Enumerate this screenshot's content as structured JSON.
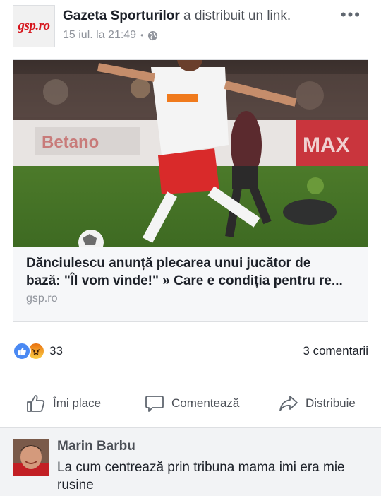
{
  "post": {
    "logo_text": "gsp.ro",
    "page_name": "Gazeta Sporturilor",
    "action_text": "a distribuit un link.",
    "timestamp": "15 iul. la 21:49",
    "separator": "•",
    "more_label": "•••",
    "privacy_icon": "globe-icon"
  },
  "link": {
    "headline_line1": "Dănciulescu anunță plecarea unui jucător de",
    "headline_line2": "bază: \"Îl vom vinde!\" » Care e condiția pentru re...",
    "domain": "gsp.ro",
    "photo_sponsor": "orange"
  },
  "reactions": {
    "count": "33",
    "types": [
      "like",
      "angry"
    ],
    "comments_count": "3 comentarii"
  },
  "actions": {
    "like_label": "Îmi place",
    "comment_label": "Comentează",
    "share_label": "Distribuie"
  },
  "comment": {
    "author": "Marin Barbu",
    "text": "La cum centrează prin tribuna mama imi era mie rusine"
  },
  "colors": {
    "brand_blue": "#4a89f3",
    "logo_red": "#d6131a",
    "muted_text": "#90949c",
    "body_text": "#1d2129"
  }
}
